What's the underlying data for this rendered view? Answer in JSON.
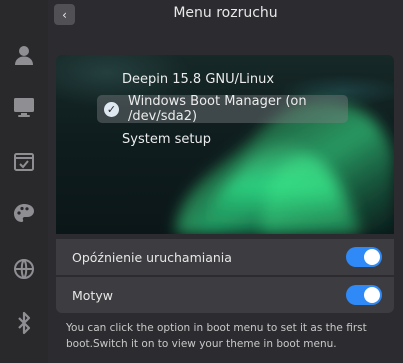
{
  "header": {
    "title": "Menu rozruchu",
    "back_icon": "chevron-left-icon"
  },
  "sidebar": {
    "items": [
      {
        "icon": "user-icon"
      },
      {
        "icon": "display-icon"
      },
      {
        "icon": "calendar-icon"
      },
      {
        "icon": "palette-icon"
      },
      {
        "icon": "network-icon"
      },
      {
        "icon": "bluetooth-icon"
      }
    ]
  },
  "boot_menu": {
    "items": [
      {
        "label": "Deepin 15.8 GNU/Linux",
        "selected": false
      },
      {
        "label": "Windows Boot Manager (on /dev/sda2)",
        "selected": true
      },
      {
        "label": "System setup",
        "selected": false
      }
    ]
  },
  "settings": {
    "startup_delay": {
      "label": "Opóźnienie uruchamiania",
      "enabled": true
    },
    "theme": {
      "label": "Motyw",
      "enabled": true
    }
  },
  "description": "You can click the option in boot menu to set it as the first boot.Switch it on to view your theme in boot menu.",
  "colors": {
    "accent": "#2f8af7",
    "background": "#2b2b2f",
    "panel": "#3d3d41"
  }
}
